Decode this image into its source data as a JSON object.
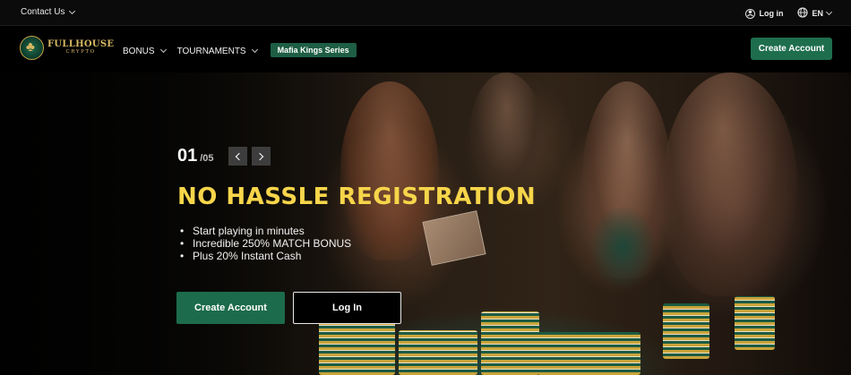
{
  "topbar": {
    "contact_label": "Contact Us",
    "login_label": "Log in",
    "language_label": "EN"
  },
  "nav": {
    "logo_line1": "FULLHOUSE",
    "logo_line2": "CRYPTO",
    "bonus_label": "BONUS",
    "tournaments_label": "TOURNAMENTS",
    "promo_badge": "Mafia Kings Series",
    "create_account_label": "Create Account"
  },
  "hero": {
    "slide_current": "01",
    "slide_total": "/05",
    "headline": "NO HASSLE REGISTRATION",
    "bullets": [
      "Start playing in minutes",
      "Incredible 250% MATCH BONUS",
      "Plus 20% Instant Cash"
    ],
    "create_account_label": "Create Account",
    "login_label": "Log In"
  },
  "colors": {
    "accent_green": "#1e6e4e",
    "headline_yellow": "#f7d54a",
    "logo_gold": "#d7b865"
  },
  "icons": [
    "chevron-down-icon",
    "user-circle-icon",
    "globe-icon",
    "club-emblem-icon",
    "arrow-left-icon",
    "arrow-right-icon"
  ]
}
